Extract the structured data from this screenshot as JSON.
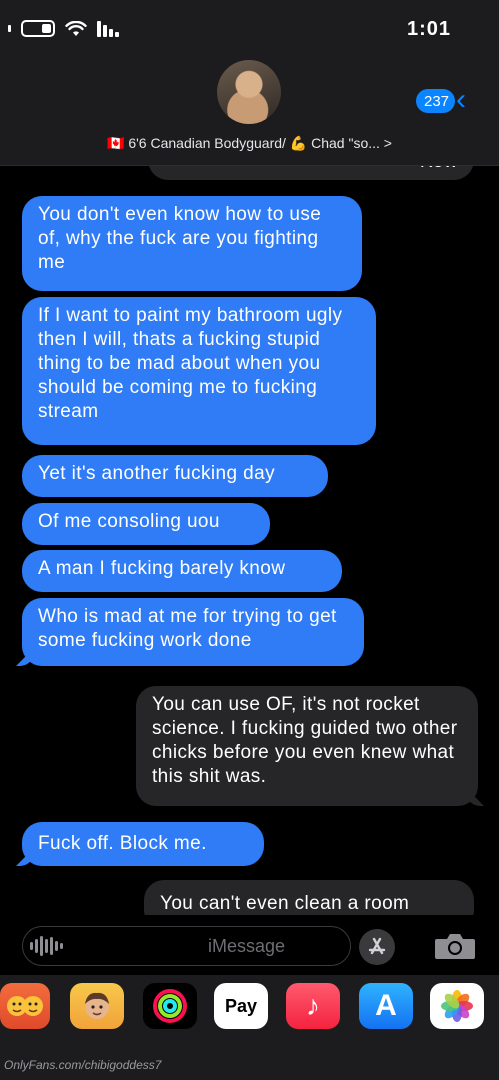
{
  "status_bar": {
    "time": "1:01"
  },
  "header": {
    "back_count": "237",
    "contact_name": "🇨🇦 6'6 Canadian Bodyguard/ 💪 Chad \"so... >"
  },
  "messages": [
    {
      "from": "them",
      "text": "Kow"
    },
    {
      "from": "me",
      "text": "You don't even know how to use of, why the fuck are you fighting me"
    },
    {
      "from": "me",
      "text": "If I want to paint my bathroom ugly then I will, thats a fucking stupid thing to be mad about when you should be coming me to fucking stream"
    },
    {
      "from": "me",
      "text": "Yet it's another fucking day"
    },
    {
      "from": "me",
      "text": "Of me consoling uou"
    },
    {
      "from": "me",
      "text": "A man I fucking barely know"
    },
    {
      "from": "me",
      "text": "Who is mad at me for trying to get some fucking work done"
    },
    {
      "from": "them",
      "text": "You can use OF, it's not rocket science. I fucking guided two other chicks before you even knew what this shit was."
    },
    {
      "from": "me",
      "text": "Fuck off. Block me."
    },
    {
      "from": "them",
      "text": "You can't even clean a room"
    }
  ],
  "input": {
    "placeholder": "iMessage"
  },
  "drawer": {
    "apps": [
      {
        "name": "photos-app",
        "label": ""
      },
      {
        "name": "app-store",
        "label": "A"
      },
      {
        "name": "music-app",
        "label": "♪"
      },
      {
        "name": "apple-pay",
        "label": "Pay"
      },
      {
        "name": "activity-app",
        "label": ""
      },
      {
        "name": "memoji",
        "label": ""
      },
      {
        "name": "memoji-stickers",
        "label": ""
      }
    ],
    "pay_label": "Pay"
  },
  "watermark": "OnlyFans.com/chibigoddess7",
  "colors": {
    "sent": "#2f7cf6",
    "received": "#262628",
    "accent": "#0a84ff",
    "header": "#1c1c1e"
  }
}
